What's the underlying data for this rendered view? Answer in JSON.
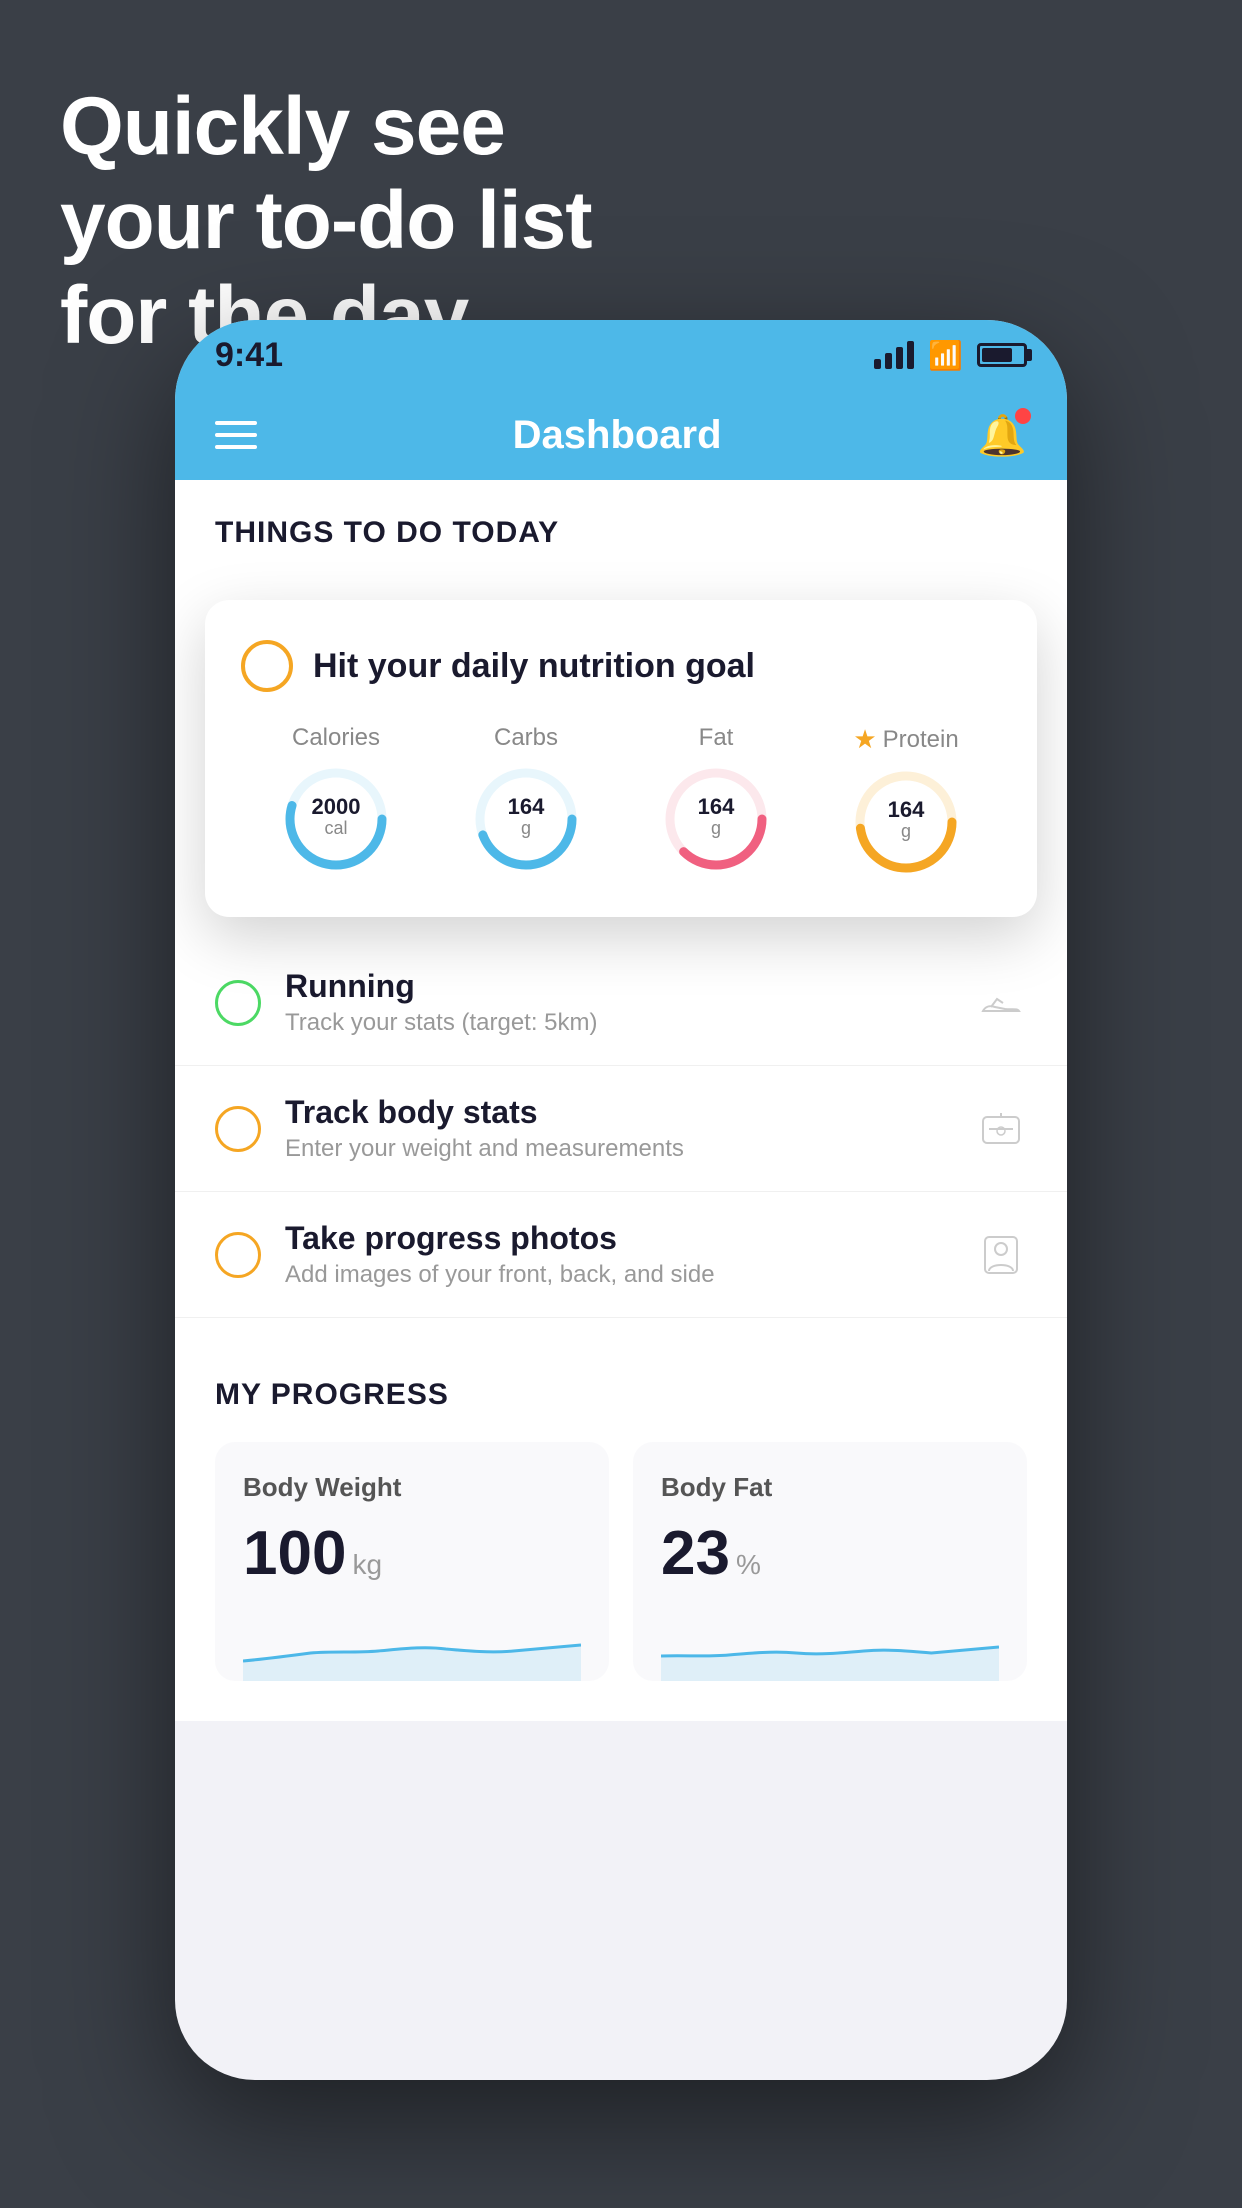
{
  "headline": {
    "line1": "Quickly see",
    "line2": "your to-do list",
    "line3": "for the day."
  },
  "phone": {
    "status_bar": {
      "time": "9:41"
    },
    "nav_bar": {
      "title": "Dashboard",
      "menu_icon": "hamburger-icon",
      "notification_icon": "bell-icon"
    },
    "section_header": "THINGS TO DO TODAY",
    "nutrition_card": {
      "checkbox_icon": "circle-check-icon",
      "title": "Hit your daily nutrition goal",
      "calories": {
        "label": "Calories",
        "value": "2000",
        "unit": "cal",
        "color": "#4db8e8"
      },
      "carbs": {
        "label": "Carbs",
        "value": "164",
        "unit": "g",
        "color": "#4db8e8"
      },
      "fat": {
        "label": "Fat",
        "value": "164",
        "unit": "g",
        "color": "#f06080"
      },
      "protein": {
        "label": "Protein",
        "value": "164",
        "unit": "g",
        "color": "#f5a623",
        "starred": true
      }
    },
    "todo_items": [
      {
        "id": "running",
        "circle_color": "green",
        "title": "Running",
        "subtitle": "Track your stats (target: 5km)",
        "icon": "shoe-icon"
      },
      {
        "id": "body-stats",
        "circle_color": "yellow",
        "title": "Track body stats",
        "subtitle": "Enter your weight and measurements",
        "icon": "scale-icon"
      },
      {
        "id": "progress-photos",
        "circle_color": "yellow",
        "title": "Take progress photos",
        "subtitle": "Add images of your front, back, and side",
        "icon": "person-icon"
      }
    ],
    "progress": {
      "header": "MY PROGRESS",
      "body_weight": {
        "title": "Body Weight",
        "value": "100",
        "unit": "kg"
      },
      "body_fat": {
        "title": "Body Fat",
        "value": "23",
        "unit": "%"
      }
    }
  }
}
